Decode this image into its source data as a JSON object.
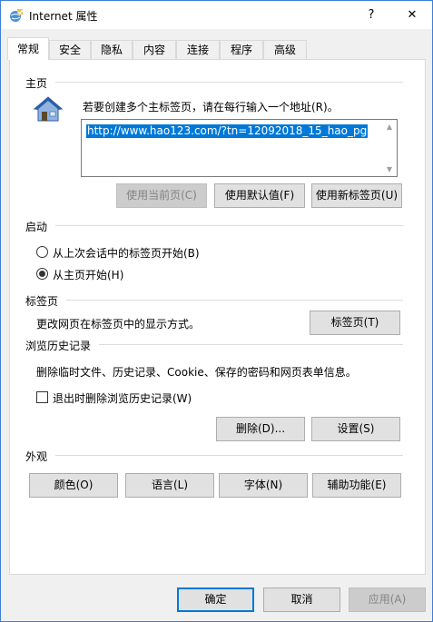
{
  "window": {
    "title": "Internet 属性",
    "help_label": "?",
    "close_label": "✕"
  },
  "tabs": [
    {
      "label": "常规",
      "active": true
    },
    {
      "label": "安全"
    },
    {
      "label": "隐私"
    },
    {
      "label": "内容"
    },
    {
      "label": "连接"
    },
    {
      "label": "程序"
    },
    {
      "label": "高级"
    }
  ],
  "homepage": {
    "section_label": "主页",
    "instruction": "若要创建多个主标签页，请在每行输入一个地址(R)。",
    "url_value": "http://www.hao123.com/?tn=12092018_15_hao_pg",
    "use_current_label": "使用当前页(C)",
    "use_default_label": "使用默认值(F)",
    "use_new_tab_label": "使用新标签页(U)"
  },
  "startup": {
    "section_label": "启动",
    "option_last_session": "从上次会话中的标签页开始(B)",
    "option_home": "从主页开始(H)",
    "selected": "home"
  },
  "tabs_section": {
    "section_label": "标签页",
    "description": "更改网页在标签页中的显示方式。",
    "button_label": "标签页(T)"
  },
  "history": {
    "section_label": "浏览历史记录",
    "description": "删除临时文件、历史记录、Cookie、保存的密码和网页表单信息。",
    "checkbox_label": "退出时删除浏览历史记录(W)",
    "delete_label": "删除(D)...",
    "settings_label": "设置(S)"
  },
  "appearance": {
    "section_label": "外观",
    "colors_label": "颜色(O)",
    "languages_label": "语言(L)",
    "fonts_label": "字体(N)",
    "accessibility_label": "辅助功能(E)"
  },
  "footer": {
    "ok_label": "确定",
    "cancel_label": "取消",
    "apply_label": "应用(A)"
  },
  "colors": {
    "accent": "#0078d7",
    "window_border": "#3f7fd9",
    "house_roof": "#2b5ea8",
    "house_wall": "#8fb4e0"
  }
}
